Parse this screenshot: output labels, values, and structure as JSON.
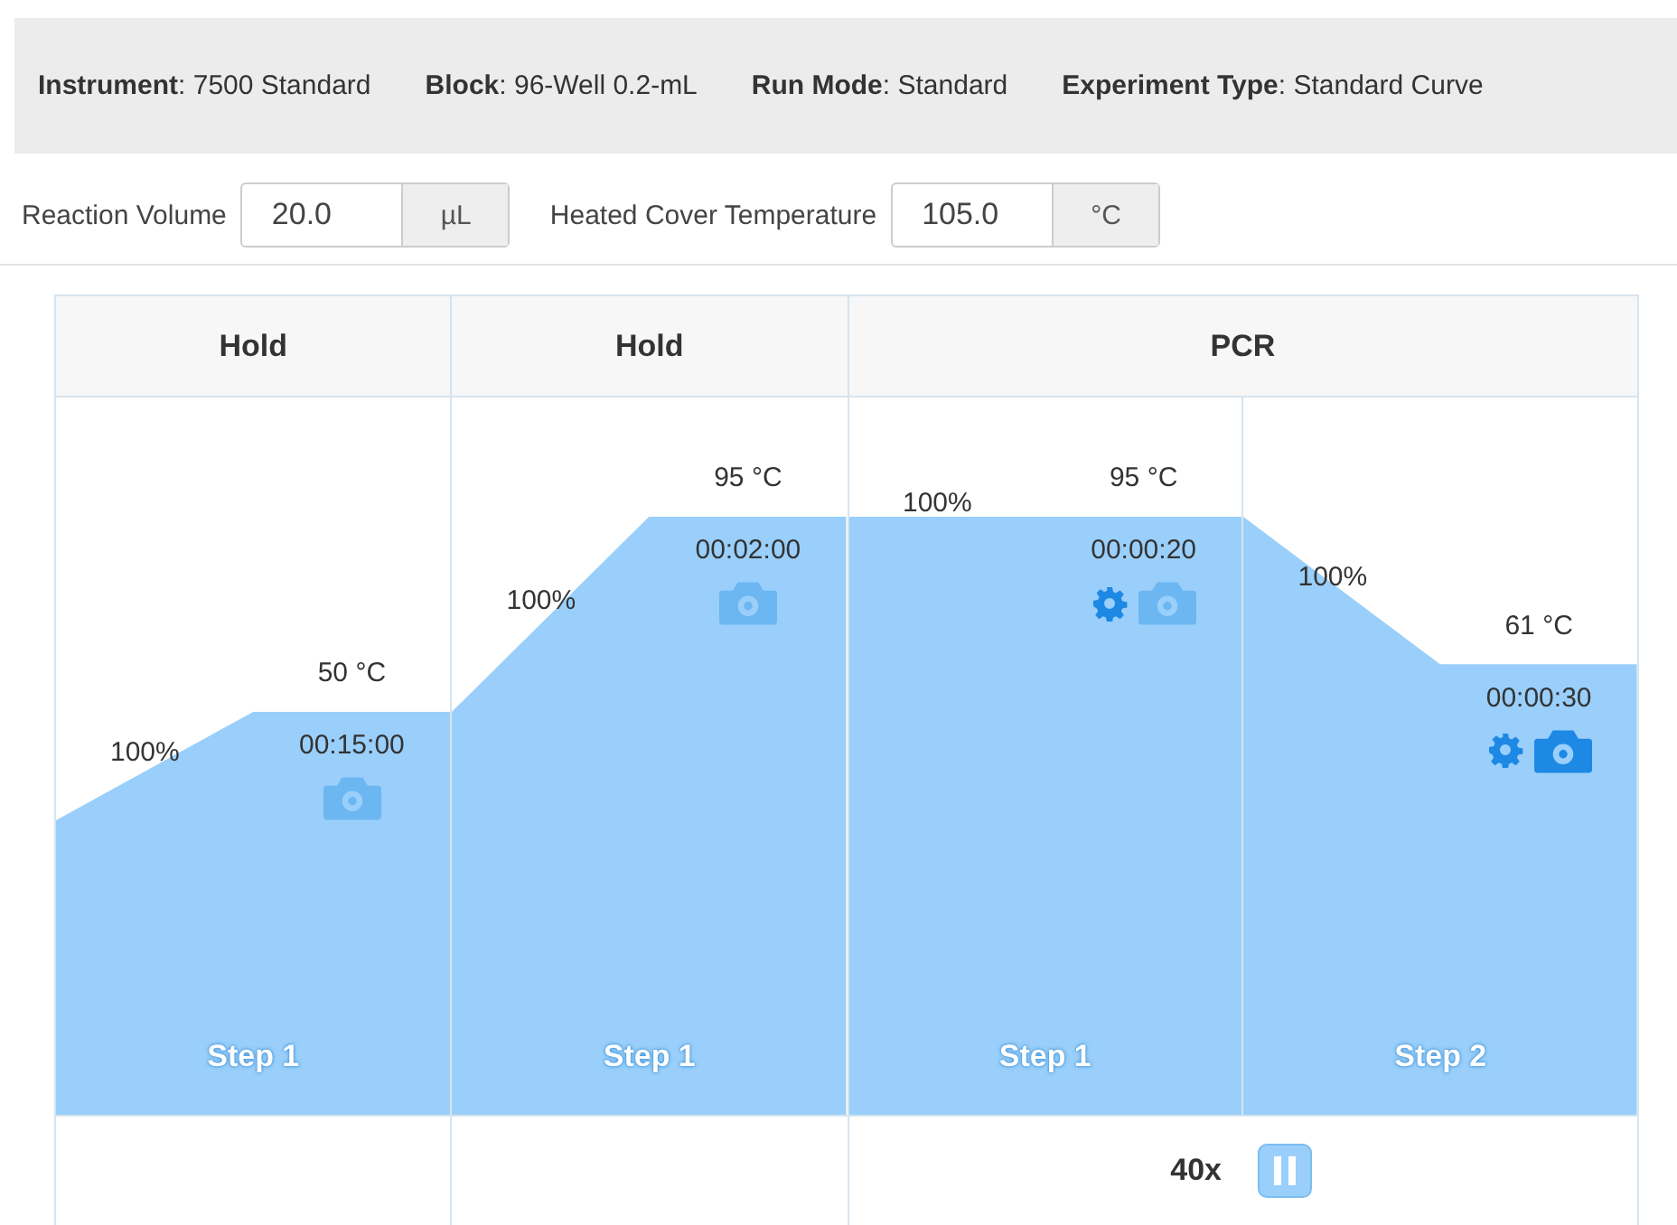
{
  "info_bar": [
    "**Instrument**: 7500 Standard",
    "**Block**: 96-Well 0.2-mL",
    "**Run Mode**: Standard",
    "**Experiment Type**: Standard Curve"
  ],
  "fields": [
    {
      "label": "Reaction Volume",
      "value": "20.0",
      "unit": "µL"
    },
    {
      "label": "Heated Cover Temperature",
      "value": "105.0",
      "unit": "°C"
    }
  ],
  "stages": [
    {
      "name": "Hold",
      "steps": [
        {
          "label": "Step 1",
          "ramp": "100%",
          "temperature": "50 °C",
          "time": "00:15:00",
          "settings": false,
          "collect": false
        }
      ]
    },
    {
      "name": "Hold",
      "steps": [
        {
          "label": "Step 1",
          "ramp": "100%",
          "temperature": "95 °C",
          "time": "00:02:00",
          "settings": false,
          "collect": false
        }
      ]
    },
    {
      "name": "PCR",
      "cycles": "40x",
      "steps": [
        {
          "label": "Step 1",
          "ramp": "100%",
          "temperature": "95 °C",
          "time": "00:00:20",
          "settings": true,
          "collect": false
        },
        {
          "label": "Step 2",
          "ramp": "100%",
          "temperature": "61 °C",
          "time": "00:00:30",
          "settings": true,
          "collect": true
        }
      ]
    }
  ]
}
